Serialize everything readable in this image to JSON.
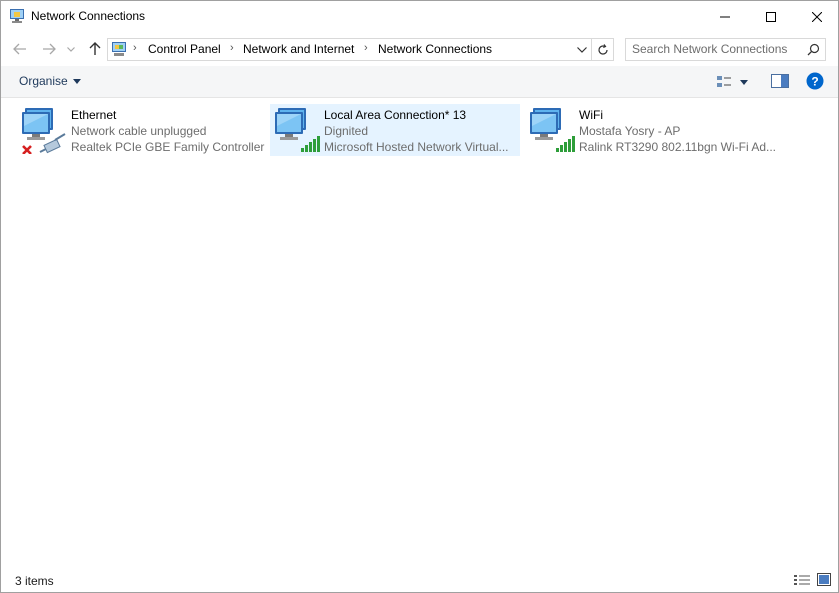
{
  "window": {
    "title": "Network Connections",
    "title_icon": "network-connections-icon",
    "controls": [
      "minimize-icon",
      "maximize-icon",
      "close-icon"
    ]
  },
  "navigation": {
    "breadcrumb": [
      "Control Panel",
      "Network and Internet",
      "Network Connections"
    ],
    "search_placeholder": "Search Network Connections"
  },
  "toolbar": {
    "organise_label": "Organise"
  },
  "connections": [
    {
      "name": "Ethernet",
      "status": "Network cable unplugged",
      "device": "Realtek PCIe GBE Family Controller",
      "icon": "ethernet-disconnected-icon",
      "selected": false
    },
    {
      "name": "Local Area Connection* 13",
      "status": "Dignited",
      "device": "Microsoft Hosted Network Virtual...",
      "icon": "network-signal-icon",
      "selected": true
    },
    {
      "name": "WiFi",
      "status": "Mostafa Yosry - AP",
      "device": "Ralink RT3290 802.11bgn Wi-Fi Ad...",
      "icon": "wifi-signal-icon",
      "selected": false
    }
  ],
  "statusbar": {
    "item_count": "3 items"
  },
  "colors": {
    "selection": "#e5f3ff",
    "accent": "#0066cc",
    "signal_green": "#2e9e3a",
    "error_red": "#d61f1f"
  }
}
